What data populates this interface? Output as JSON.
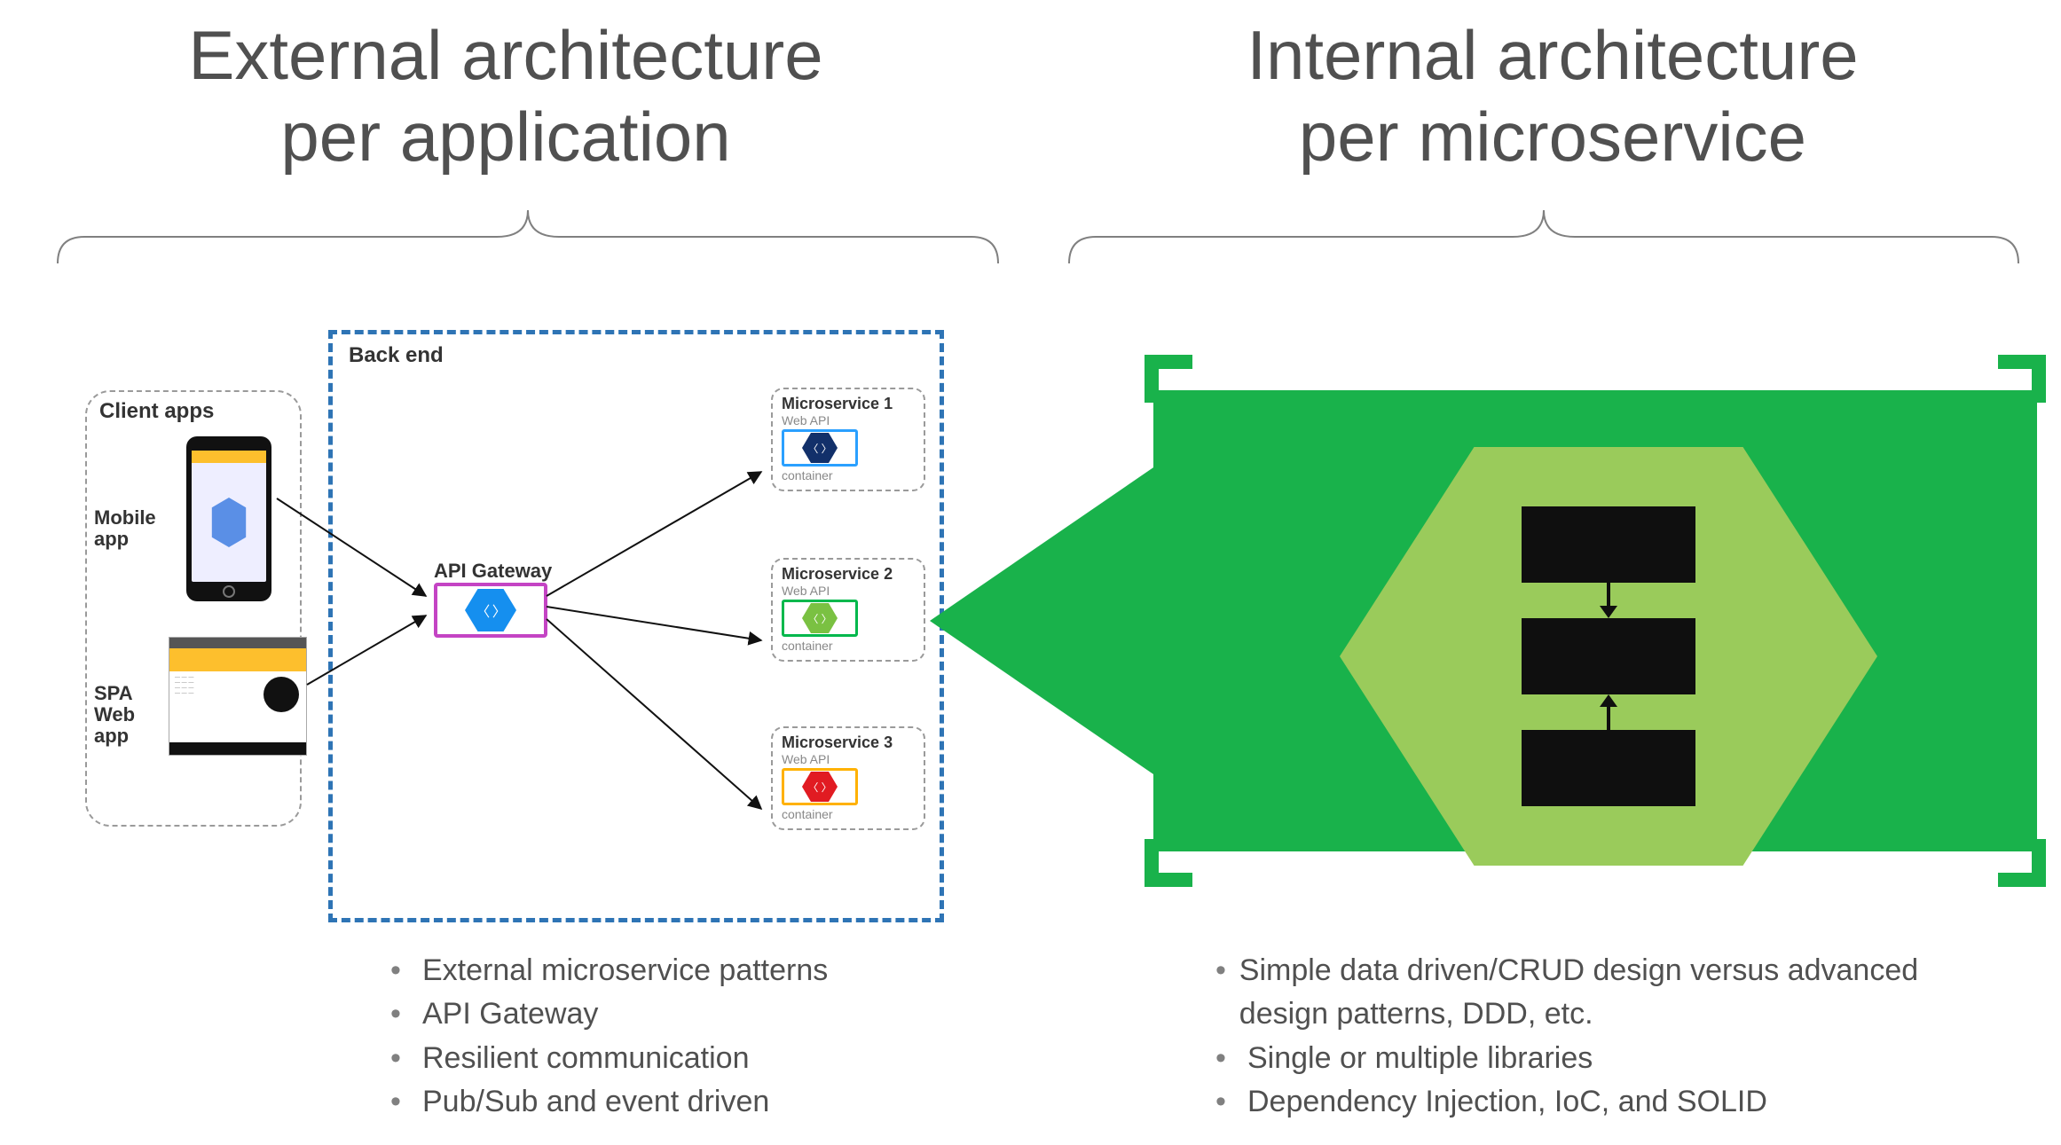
{
  "titles": {
    "left_line1": "External architecture",
    "left_line2": "per application",
    "right_line1": "Internal architecture",
    "right_line2": "per microservice"
  },
  "client_apps": {
    "section_title": "Client apps",
    "mobile_label": "Mobile app",
    "spa_label": "SPA Web app"
  },
  "backend": {
    "title": "Back end",
    "gateway_label": "API Gateway",
    "microservices": [
      {
        "title": "Microservice 1",
        "subtitle": "Web API",
        "footer": "container",
        "color": "blue"
      },
      {
        "title": "Microservice 2",
        "subtitle": "Web API",
        "footer": "container",
        "color": "green"
      },
      {
        "title": "Microservice 3",
        "subtitle": "Web API",
        "footer": "container",
        "color": "red"
      }
    ]
  },
  "bullets_left": [
    "External microservice patterns",
    "API Gateway",
    "Resilient communication",
    "Pub/Sub and event driven"
  ],
  "bullets_right": [
    "Simple data driven/CRUD design versus advanced design patterns, DDD, etc.",
    "Single or multiple libraries",
    "Dependency Injection, IoC, and SOLID"
  ],
  "colors": {
    "accent_green": "#19b24b",
    "hex_green": "#9acb5b",
    "backend_border": "#2e74b5"
  }
}
